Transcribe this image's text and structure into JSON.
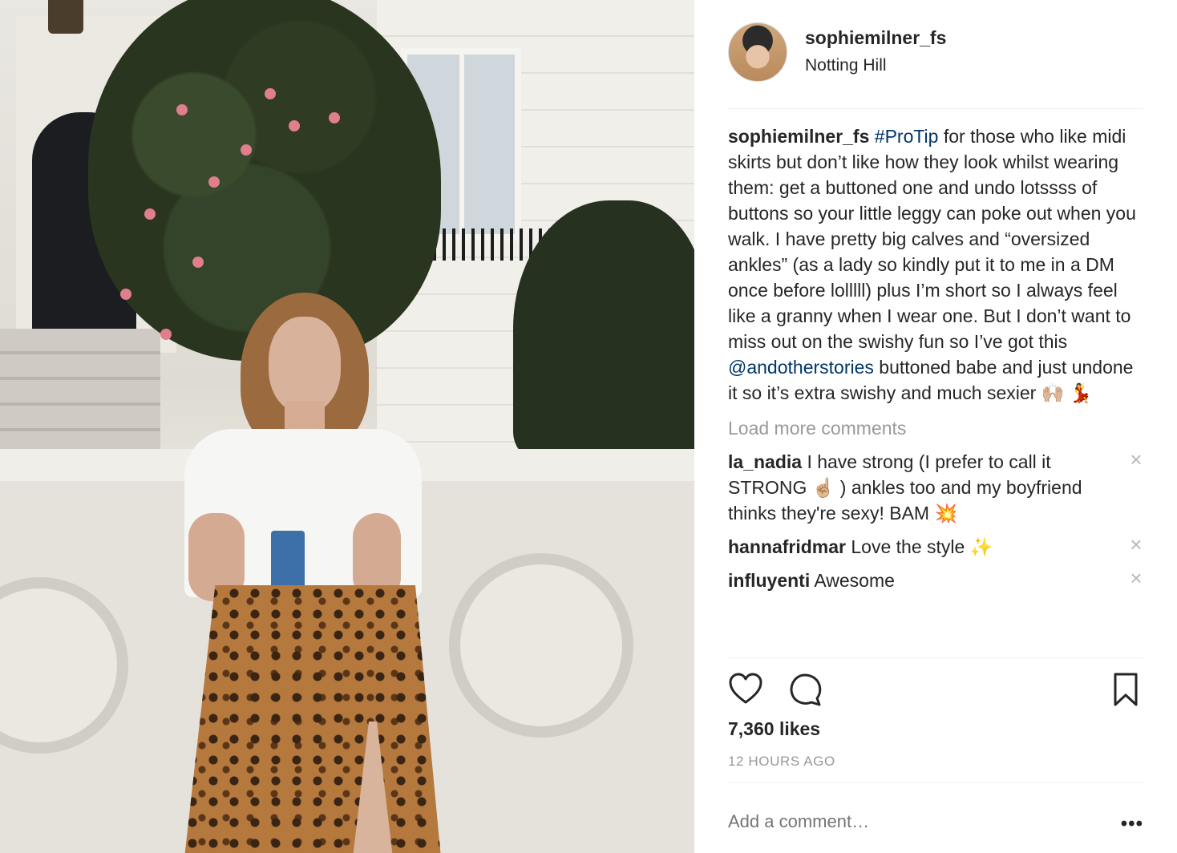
{
  "post": {
    "username": "sophiemilner_fs",
    "location": "Notting Hill"
  },
  "caption": {
    "username": "sophiemilner_fs",
    "hashtag": "#ProTip",
    "text_1": " for those who like midi skirts but don’t like how they look whilst wearing them: get a buttoned one and undo lotssss of buttons so your little leggy can poke out when you walk. I have pretty big calves and “oversized ankles” (as a lady so kindly put it to me in a DM once before lolllll) plus I’m short so I always feel like a granny when I wear one. But I don’t want to miss out on the swishy fun so I’ve got this ",
    "mention": "@andotherstories",
    "text_2": " buttoned babe and just undone it so it’s extra swishy and much sexier 🙌🏼 💃"
  },
  "load_more_label": "Load more comments",
  "comments": [
    {
      "username": "la_nadia",
      "text": "I have strong (I prefer to call it STRONG ☝🏼 ) ankles too and my boyfriend thinks they're sexy! BAM 💥"
    },
    {
      "username": "hannafridmar",
      "text": "Love the style ✨"
    },
    {
      "username": "influyenti",
      "text": "Awesome"
    }
  ],
  "icons": {
    "like": "heart-icon",
    "comment": "comment-bubble-icon",
    "save": "bookmark-icon",
    "remove": "close-icon",
    "more": "more-options-icon"
  },
  "likes": "7,360 likes",
  "time": "12 HOURS AGO",
  "add_comment_placeholder": "Add a comment…",
  "more_label": "•••",
  "colors": {
    "text": "#262626",
    "link": "#003569",
    "muted": "#999999",
    "divider": "#efefef"
  }
}
